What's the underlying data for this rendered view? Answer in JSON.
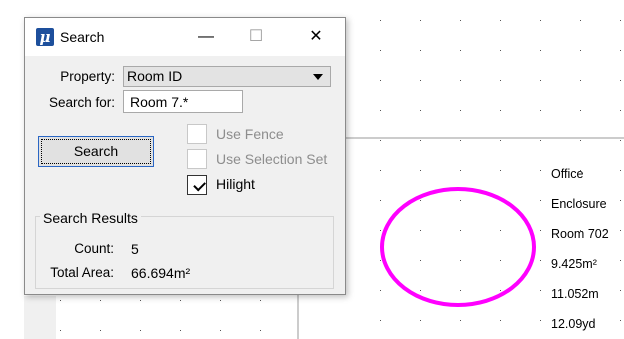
{
  "dialog": {
    "title": "Search",
    "app_icon_glyph": "μ",
    "minimize_glyph": "—",
    "maximize_glyph": "☐",
    "close_glyph": "✕",
    "property_label": "Property:",
    "property_value": "Room ID",
    "search_for_label": "Search for:",
    "search_for_value": "Room 7.*",
    "search_button": "Search",
    "checkboxes": [
      {
        "label": "Use Fence",
        "checked": false,
        "enabled": false
      },
      {
        "label": "Use Selection Set",
        "checked": false,
        "enabled": false
      },
      {
        "label": "Hilight",
        "checked": true,
        "enabled": true
      }
    ],
    "results": {
      "title": "Search Results",
      "count_label": "Count:",
      "count_value": "5",
      "area_label": "Total Area:",
      "area_value": "66.694m²"
    }
  },
  "cad": {
    "labels": [
      "Office",
      "Enclosure",
      "Room 702",
      "9.425m²",
      "11.052m",
      "12.09yd"
    ],
    "highlight_color": "#ff00ff"
  }
}
